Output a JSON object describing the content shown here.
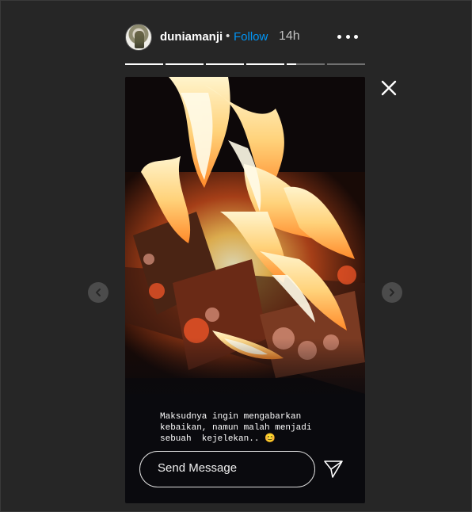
{
  "story": {
    "username": "duniamanji",
    "separator": "•",
    "follow_label": "Follow",
    "time_ago": "14h",
    "caption": "Maksudnya ingin mengabarkan\nkebaikan, namun malah menjadi\nsebuah  kejelekan.. 😊",
    "progress": [
      1,
      1,
      1,
      1,
      0.25,
      0
    ],
    "message_placeholder": "Send Message"
  },
  "icons": {
    "more": "more-options-icon",
    "close": "close-icon",
    "send": "send-icon",
    "prev": "chevron-left-icon",
    "next": "chevron-right-icon"
  },
  "colors": {
    "background": "#262626",
    "follow": "#0095f6",
    "story_bg": "#0a0a0e"
  }
}
